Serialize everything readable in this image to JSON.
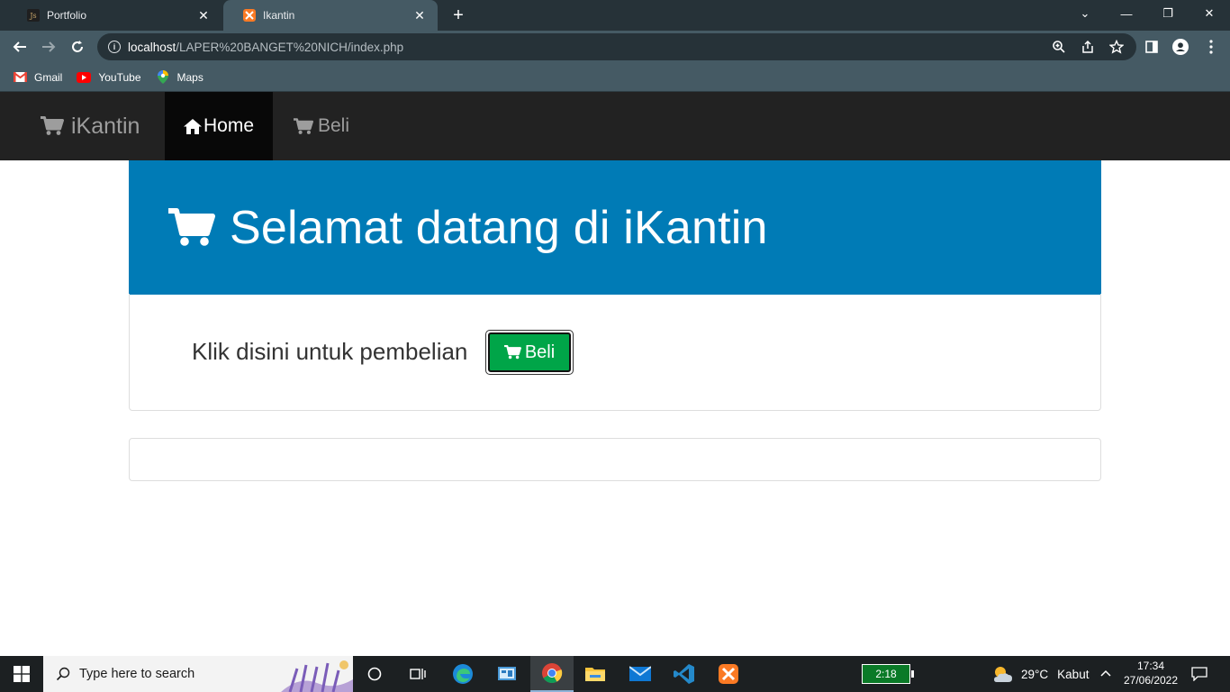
{
  "browser": {
    "tabs": [
      {
        "title": "Portfolio",
        "active": false
      },
      {
        "title": "Ikantin",
        "active": true
      }
    ],
    "new_tab": "+",
    "window_controls": {
      "dropdown": "⌄",
      "minimize": "—",
      "restore": "❐",
      "close": "✕"
    },
    "address": {
      "host": "localhost",
      "path": "/LAPER%20BANGET%20NICH/index.php"
    },
    "bookmarks": [
      {
        "label": "Gmail",
        "icon": "gmail-icon"
      },
      {
        "label": "YouTube",
        "icon": "youtube-icon"
      },
      {
        "label": "Maps",
        "icon": "maps-icon"
      }
    ]
  },
  "page": {
    "brand": "iKantin",
    "nav": [
      {
        "label": "Home",
        "icon": "home-icon",
        "active": true
      },
      {
        "label": "Beli",
        "icon": "cart-icon",
        "active": false
      }
    ],
    "jumbotron": {
      "heading": "Selamat datang di iKantin",
      "color": "#007bb6"
    },
    "content": {
      "text": "Klik disini untuk pembelian",
      "button_label": "Beli",
      "button_color": "#00a548"
    }
  },
  "taskbar": {
    "search_placeholder": "Type here to search",
    "battery": "2:18",
    "weather": {
      "temp": "29°C",
      "condition": "Kabut"
    },
    "time": "17:34",
    "date": "27/06/2022"
  }
}
